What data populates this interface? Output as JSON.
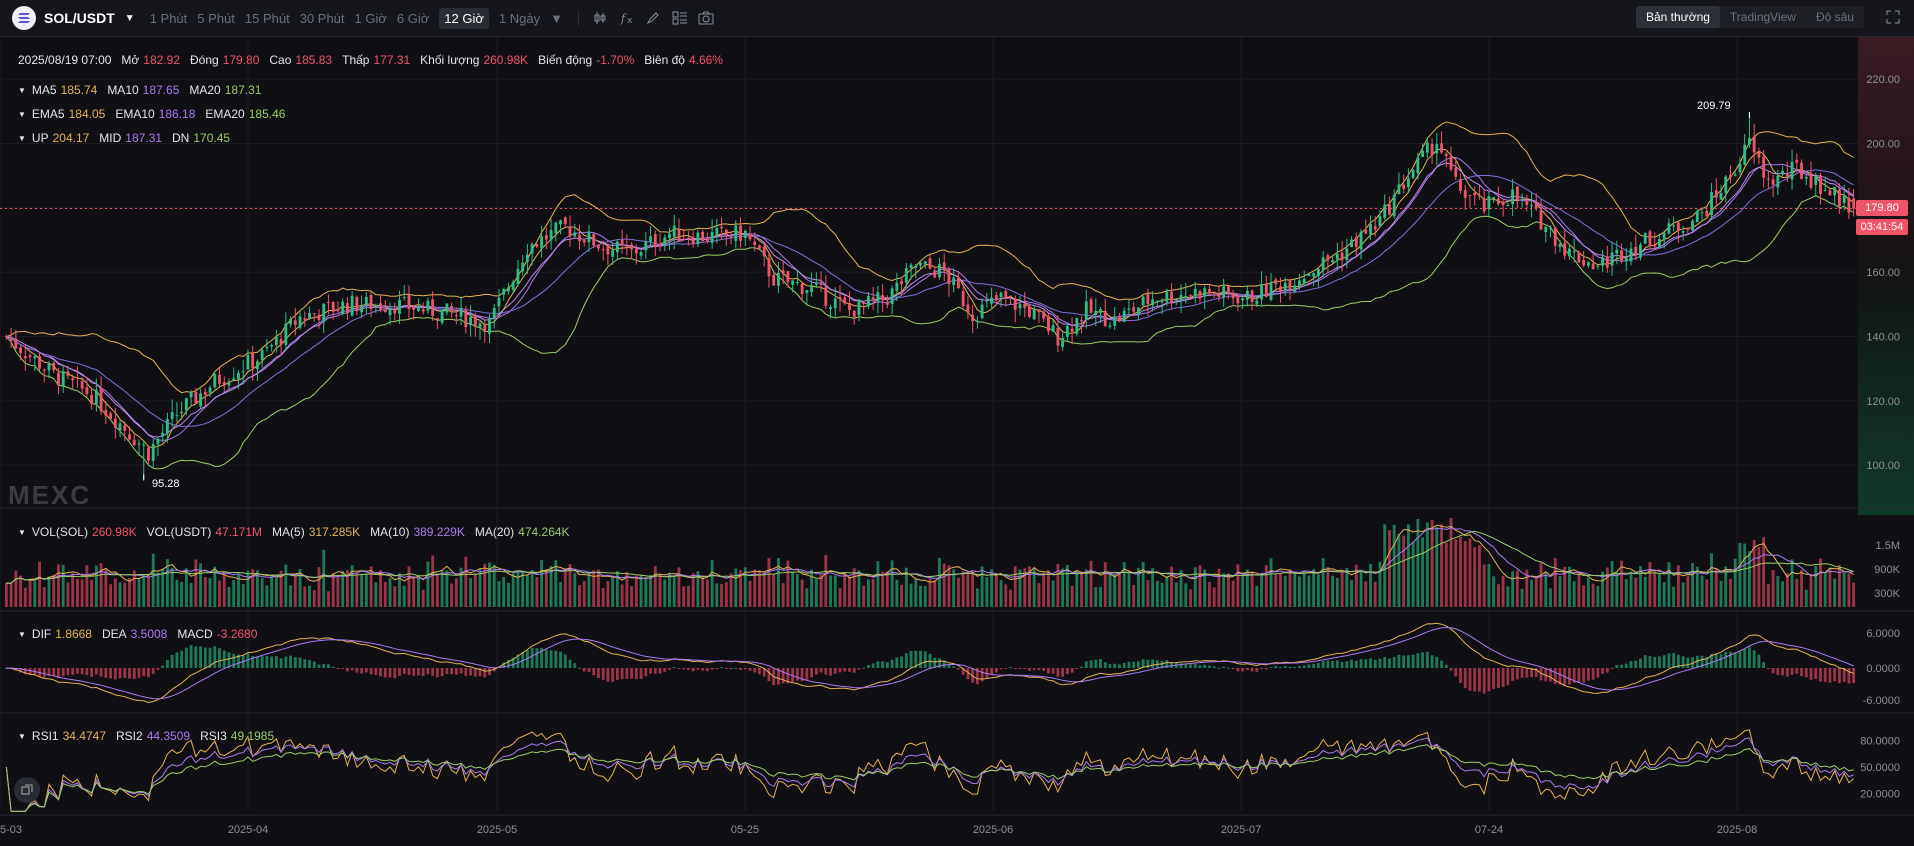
{
  "toolbar": {
    "pair": "SOL/USDT",
    "timeframes": [
      "1 Phút",
      "5 Phút",
      "15 Phút",
      "30 Phút",
      "1 Giờ",
      "6 Giờ",
      "12 Giờ",
      "1 Ngày"
    ],
    "active_timeframe": "12 Giờ",
    "views": [
      "Bản thường",
      "TradingView",
      "Độ sâu"
    ],
    "active_view": "Bản thường",
    "tools": [
      "indicator-icon",
      "fx-icon",
      "pencil-icon",
      "layout-icon",
      "camera-icon"
    ]
  },
  "legend": {
    "ohlc": {
      "date": "2025/08/19 07:00",
      "open_label": "Mở",
      "open": "182.92",
      "close_label": "Đóng",
      "close": "179.80",
      "high_label": "Cao",
      "high": "185.83",
      "low_label": "Thấp",
      "low": "177.31",
      "vol_label": "Khối lượng",
      "vol": "260.98K",
      "chg_label": "Biến động",
      "chg": "-1.70%",
      "amp_label": "Biên độ",
      "amp": "4.66%"
    },
    "ma": {
      "ma5_label": "MA5",
      "ma5": "185.74",
      "ma10_label": "MA10",
      "ma10": "187.65",
      "ma20_label": "MA20",
      "ma20": "187.31"
    },
    "ema": {
      "ema5_label": "EMA5",
      "ema5": "184.05",
      "ema10_label": "EMA10",
      "ema10": "186.18",
      "ema20_label": "EMA20",
      "ema20": "185.46"
    },
    "boll": {
      "up_label": "UP",
      "up": "204.17",
      "mid_label": "MID",
      "mid": "187.31",
      "dn_label": "DN",
      "dn": "170.45"
    },
    "vol": {
      "sol_label": "VOL(SOL)",
      "sol": "260.98K",
      "usdt_label": "VOL(USDT)",
      "usdt": "47.171M",
      "ma5_label": "MA(5)",
      "ma5": "317.285K",
      "ma10_label": "MA(10)",
      "ma10": "389.229K",
      "ma20_label": "MA(20)",
      "ma20": "474.264K"
    },
    "macd": {
      "dif_label": "DIF",
      "dif": "1.8668",
      "dea_label": "DEA",
      "dea": "3.5008",
      "macd_label": "MACD",
      "macd": "-3.2680"
    },
    "rsi": {
      "rsi1_label": "RSI1",
      "rsi1": "34.4747",
      "rsi2_label": "RSI2",
      "rsi2": "44.3509",
      "rsi3_label": "RSI3",
      "rsi3": "49.1985"
    }
  },
  "watermark": "MEXC",
  "price_tag": {
    "price": "179.80",
    "countdown": "03:41:54"
  },
  "annotations": {
    "max": "209.79",
    "min": "95.28"
  },
  "colors": {
    "up": "#2dbd85",
    "down": "#f05468",
    "ma5": "#e3b257",
    "ma10": "#a97bf0",
    "ma20": "#9ccb6a",
    "boll": "#e3b257"
  },
  "chart_data": {
    "type": "candlestick",
    "symbol": "SOL/USDT",
    "interval": "12h",
    "x_ticks": [
      "5-03",
      "2025-04",
      "2025-05",
      "05-25",
      "2025-06",
      "2025-07",
      "07-24",
      "2025-08"
    ],
    "price_axis": {
      "ticks": [
        100,
        120,
        140,
        160,
        180,
        200,
        220
      ],
      "ylim": [
        87,
        230
      ]
    },
    "volume_axis": {
      "ticks": [
        "300K",
        "900K",
        "1.5M"
      ]
    },
    "macd_axis": {
      "ticks": [
        "6.0000",
        "0.0000",
        "-6.0000"
      ]
    },
    "rsi_axis": {
      "ticks": [
        "80.0000",
        "50.0000",
        "20.0000"
      ]
    },
    "last_price": 179.8,
    "period_high": 209.79,
    "period_low": 95.28,
    "close_path": [
      {
        "t": 0,
        "v": 140
      },
      {
        "t": 10,
        "v": 128
      },
      {
        "t": 18,
        "v": 122
      },
      {
        "t": 26,
        "v": 110
      },
      {
        "t": 30,
        "v": 104
      },
      {
        "t": 36,
        "v": 116
      },
      {
        "t": 44,
        "v": 126
      },
      {
        "t": 54,
        "v": 134
      },
      {
        "t": 62,
        "v": 146
      },
      {
        "t": 72,
        "v": 150
      },
      {
        "t": 82,
        "v": 150
      },
      {
        "t": 94,
        "v": 147
      },
      {
        "t": 102,
        "v": 144
      },
      {
        "t": 110,
        "v": 168
      },
      {
        "t": 118,
        "v": 174
      },
      {
        "t": 126,
        "v": 168
      },
      {
        "t": 132,
        "v": 166
      },
      {
        "t": 140,
        "v": 172
      },
      {
        "t": 148,
        "v": 171
      },
      {
        "t": 156,
        "v": 172
      },
      {
        "t": 162,
        "v": 158
      },
      {
        "t": 170,
        "v": 155
      },
      {
        "t": 178,
        "v": 148
      },
      {
        "t": 186,
        "v": 152
      },
      {
        "t": 192,
        "v": 162
      },
      {
        "t": 198,
        "v": 160
      },
      {
        "t": 204,
        "v": 147
      },
      {
        "t": 210,
        "v": 152
      },
      {
        "t": 216,
        "v": 148
      },
      {
        "t": 222,
        "v": 140
      },
      {
        "t": 228,
        "v": 148
      },
      {
        "t": 234,
        "v": 145
      },
      {
        "t": 242,
        "v": 152
      },
      {
        "t": 252,
        "v": 154
      },
      {
        "t": 262,
        "v": 152
      },
      {
        "t": 272,
        "v": 158
      },
      {
        "t": 282,
        "v": 166
      },
      {
        "t": 290,
        "v": 176
      },
      {
        "t": 296,
        "v": 190
      },
      {
        "t": 302,
        "v": 201
      },
      {
        "t": 306,
        "v": 187
      },
      {
        "t": 312,
        "v": 180
      },
      {
        "t": 318,
        "v": 184
      },
      {
        "t": 324,
        "v": 176
      },
      {
        "t": 330,
        "v": 166
      },
      {
        "t": 336,
        "v": 162
      },
      {
        "t": 342,
        "v": 167
      },
      {
        "t": 350,
        "v": 172
      },
      {
        "t": 358,
        "v": 178
      },
      {
        "t": 364,
        "v": 190
      },
      {
        "t": 368,
        "v": 200
      },
      {
        "t": 372,
        "v": 188
      },
      {
        "t": 378,
        "v": 192
      },
      {
        "t": 384,
        "v": 186
      },
      {
        "t": 390,
        "v": 179.8
      }
    ]
  }
}
